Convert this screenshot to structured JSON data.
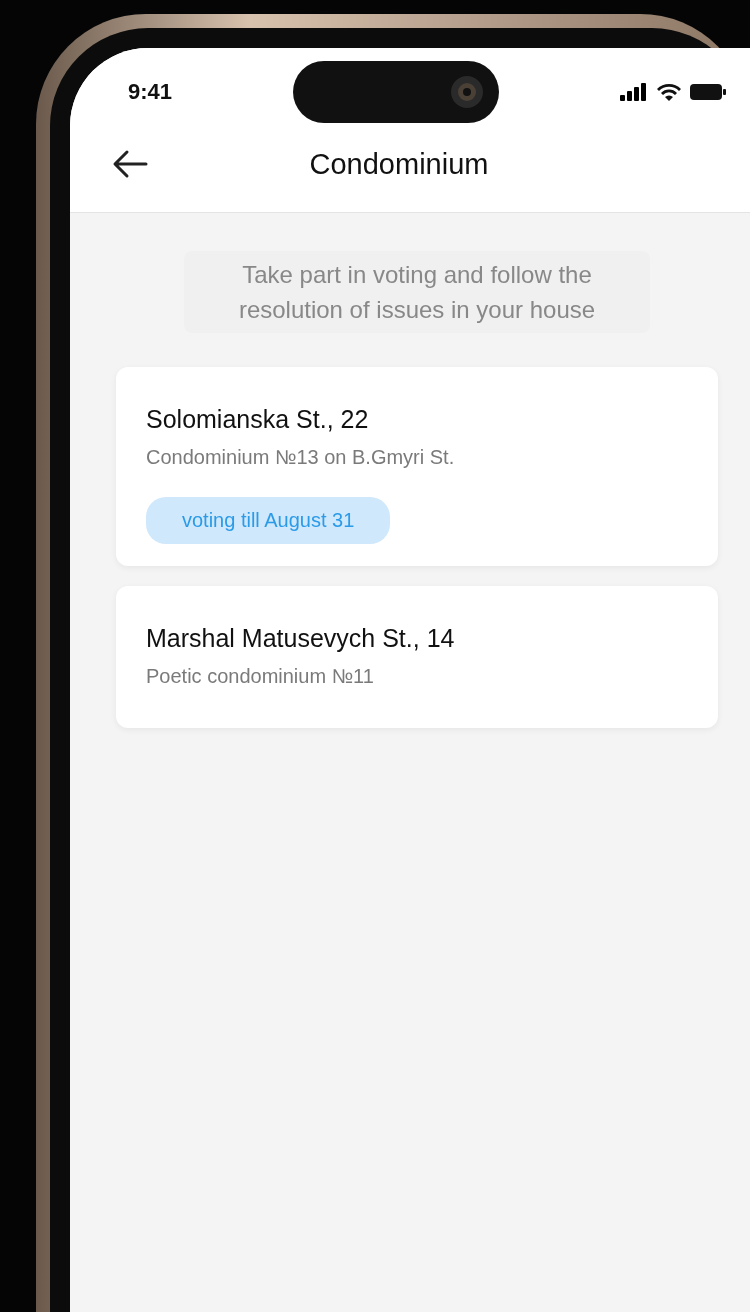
{
  "status_bar": {
    "time": "9:41"
  },
  "header": {
    "title": "Condominium"
  },
  "intro": "Take part in voting and follow the resolution of issues in your house",
  "cards": [
    {
      "title": "Solomianska St., 22",
      "subtitle": "Condominium №13 on B.Gmyri St.",
      "badge": "voting till August 31"
    },
    {
      "title": "Marshal Matusevych St., 14",
      "subtitle": "Poetic condominium №11"
    }
  ]
}
